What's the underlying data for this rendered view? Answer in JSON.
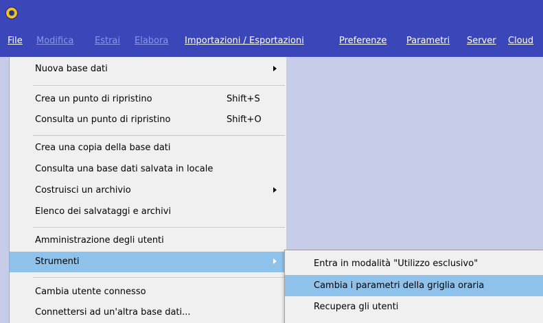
{
  "app": {
    "icon": "app-logo-icon"
  },
  "menubar": {
    "items": [
      {
        "label": "File",
        "enabled": true
      },
      {
        "label": "Modifica",
        "enabled": false
      },
      {
        "label": "Estrai",
        "enabled": false
      },
      {
        "label": "Elabora",
        "enabled": false
      },
      {
        "label": "Importazioni / Esportazioni",
        "enabled": true
      },
      {
        "label": "Preferenze",
        "enabled": true
      },
      {
        "label": "Parametri",
        "enabled": true
      },
      {
        "label": "Server",
        "enabled": true
      },
      {
        "label": "Cloud",
        "enabled": true
      }
    ]
  },
  "file_menu": {
    "items": [
      {
        "label": "Nuova base dati",
        "shortcut": "",
        "submenu": true
      },
      {
        "label": "Crea un punto di ripristino",
        "shortcut": "Shift+S"
      },
      {
        "label": "Consulta un punto di ripristino",
        "shortcut": "Shift+O"
      },
      {
        "label": "Crea una copia della base dati"
      },
      {
        "label": "Consulta una base dati salvata in locale"
      },
      {
        "label": "Costruisci un archivio",
        "submenu": true
      },
      {
        "label": "Elenco dei salvataggi e archivi"
      },
      {
        "label": "Amministrazione degli utenti"
      },
      {
        "label": "Strumenti",
        "submenu": true,
        "highlighted": true
      },
      {
        "label": "Cambia utente connesso"
      },
      {
        "label": "Connettersi ad un'altra base dati..."
      }
    ]
  },
  "strumenti_submenu": {
    "items": [
      {
        "label": "Entra in modalità \"Utilizzo esclusivo\""
      },
      {
        "label": "Cambia i parametri della griglia oraria",
        "highlighted": true
      },
      {
        "label": "Recupera gli utenti"
      }
    ]
  },
  "colors": {
    "menubar": "#3b46b8",
    "workspace": "#c7cde9",
    "highlight": "#8fc2ea"
  }
}
